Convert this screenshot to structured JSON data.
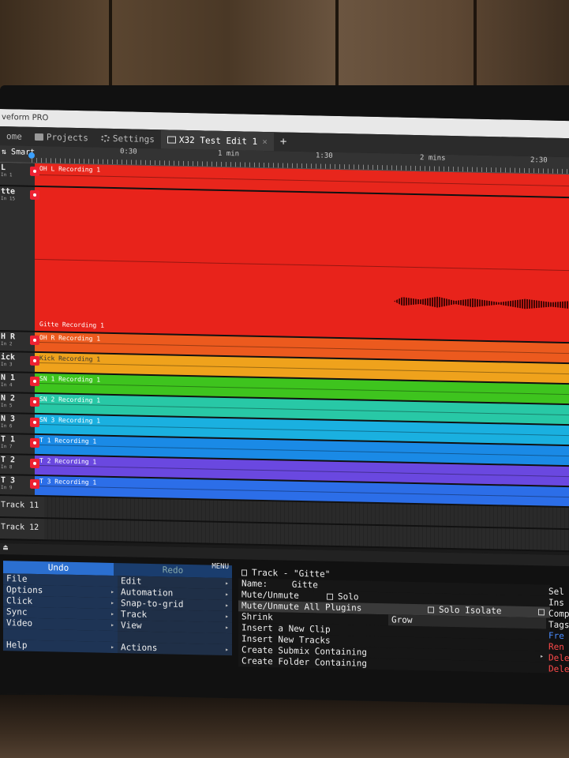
{
  "window": {
    "title": "veform PRO"
  },
  "tabs": [
    {
      "label": "ome"
    },
    {
      "label": "Projects",
      "icon": "folder-icon"
    },
    {
      "label": "Settings",
      "icon": "gear-icon"
    },
    {
      "label": "X32 Test Edit 1",
      "icon": "edit-icon",
      "active": true
    }
  ],
  "toolbar": {
    "add_tab": "+",
    "smart_label": "Smart"
  },
  "ruler": {
    "labels": [
      "0:30",
      "1 min",
      "1:30",
      "2 mins",
      "2:30"
    ]
  },
  "tracks": [
    {
      "name": "L",
      "input": "In 1",
      "clip": "OH L Recording 1",
      "color": "#e8261c",
      "height": 30
    },
    {
      "name": "tte",
      "input": "In 15",
      "clip": "Gitte Recording 1",
      "color": "#e8231b",
      "height": 184,
      "has_wave": true
    },
    {
      "name": "H R",
      "input": "In 2",
      "clip": "OH R Recording 1",
      "color": "#ec5a1e",
      "height": 26
    },
    {
      "name": "ick",
      "input": "In 3",
      "clip": "Kick Recording 1",
      "color": "#efa21c",
      "height": 26,
      "dark": true
    },
    {
      "name": "N 1",
      "input": "In 4",
      "clip": "SN 1 Recording 1",
      "color": "#3ec41e",
      "height": 26
    },
    {
      "name": "N 2",
      "input": "In 5",
      "clip": "SN 2 Recording 1",
      "color": "#28c8a6",
      "height": 26
    },
    {
      "name": "N 3",
      "input": "In 6",
      "clip": "SN 3 Recording 1",
      "color": "#1ab0e0",
      "height": 26
    },
    {
      "name": "T 1",
      "input": "In 7",
      "clip": "T 1 Recording 1",
      "color": "#1a8ae6",
      "height": 26
    },
    {
      "name": "T 2",
      "input": "In 8",
      "clip": "T 2 Recording 1",
      "color": "#6a48e0",
      "height": 26
    },
    {
      "name": "T 3",
      "input": "In 9",
      "clip": "T 3 Recording 1",
      "color": "#2c6ee8",
      "height": 26
    }
  ],
  "empty_tracks": [
    "Track 11",
    "Track 12"
  ],
  "menu": {
    "undo": "Undo",
    "redo": "Redo",
    "menu_label": "MENU",
    "left": [
      "File",
      "Options",
      "Click",
      "Sync",
      "Video",
      "",
      "Help"
    ],
    "right": [
      "Edit",
      "Automation",
      "Snap-to-grid",
      "Track",
      "View",
      "",
      "Actions"
    ]
  },
  "track_panel": {
    "title": "Track - \"Gitte\"",
    "name_label": "Name:",
    "name_value": "Gitte",
    "mute": "Mute/Unmute",
    "solo": "Solo",
    "mute_all": "Mute/Unmute All Plugins",
    "solo_isolate": "Solo Isolate",
    "shrink": "Shrink",
    "grow": "Grow",
    "insert_clip": "Insert a New Clip",
    "insert_tracks": "Insert New Tracks",
    "submix": "Create Submix Containing",
    "folder": "Create Folder Containing"
  },
  "edge_items": [
    "Sel",
    "Ins",
    "Comp",
    "Tags",
    "Fre",
    "Ren",
    "Dele",
    "Dele"
  ]
}
